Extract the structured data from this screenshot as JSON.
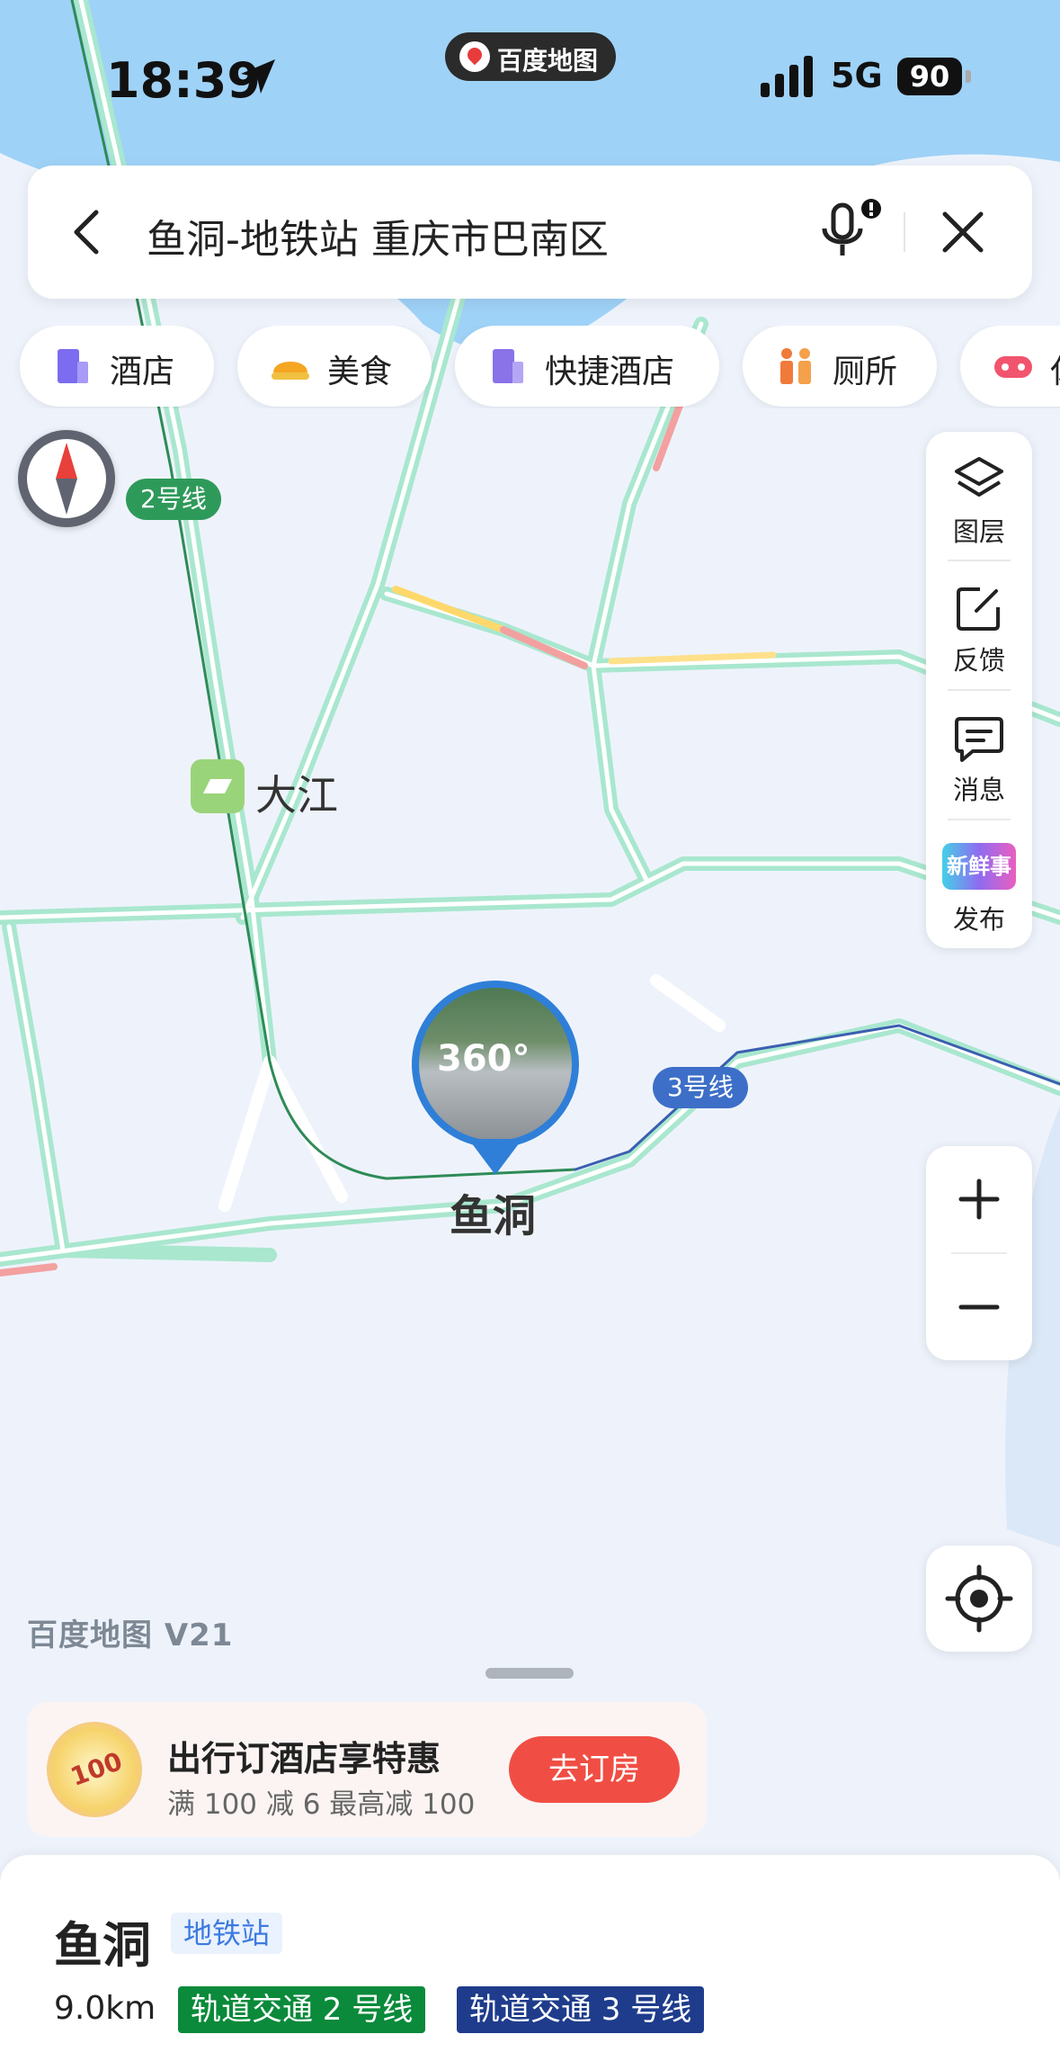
{
  "status_bar": {
    "time": "18:39",
    "app_name": "百度地图",
    "network": "5G",
    "battery": "90"
  },
  "search": {
    "query": "鱼洞-地铁站 重庆市巴南区"
  },
  "categories": [
    {
      "label": "酒店",
      "icon": "hotel-icon"
    },
    {
      "label": "美食",
      "icon": "food-icon"
    },
    {
      "label": "快捷酒店",
      "icon": "budget-hotel-icon"
    },
    {
      "label": "厕所",
      "icon": "toilet-icon"
    },
    {
      "label": "休",
      "icon": "entertainment-icon"
    }
  ],
  "map": {
    "line2_label": "2号线",
    "line3_label": "3号线",
    "station_dajiang": "大江",
    "selected_poi": "鱼洞",
    "panorama_badge": "360°",
    "watermark": "百度地图 V21",
    "colors": {
      "water": "#9fd2f7",
      "land": "#eef3fb",
      "road": "#a9e7cf",
      "line2": "#2e8b57",
      "line3": "#3b5fb0"
    }
  },
  "tools": [
    {
      "label": "图层",
      "icon": "layers-icon"
    },
    {
      "label": "反馈",
      "icon": "feedback-icon"
    },
    {
      "label": "消息",
      "icon": "message-icon"
    },
    {
      "label": "发布",
      "icon": "publish-icon",
      "badge": "新鲜事"
    }
  ],
  "promo": {
    "title": "出行订酒店享特惠",
    "subtitle": "满 100 减 6  最高减 100",
    "button": "去订房",
    "coupon": "100"
  },
  "poi": {
    "name": "鱼洞",
    "type": "地铁站",
    "distance": "9.0km",
    "lines": [
      {
        "label": "轨道交通 2 号线",
        "color": "#0a8a3a"
      },
      {
        "label": "轨道交通 3 号线",
        "color": "#1f3c8c"
      }
    ]
  }
}
